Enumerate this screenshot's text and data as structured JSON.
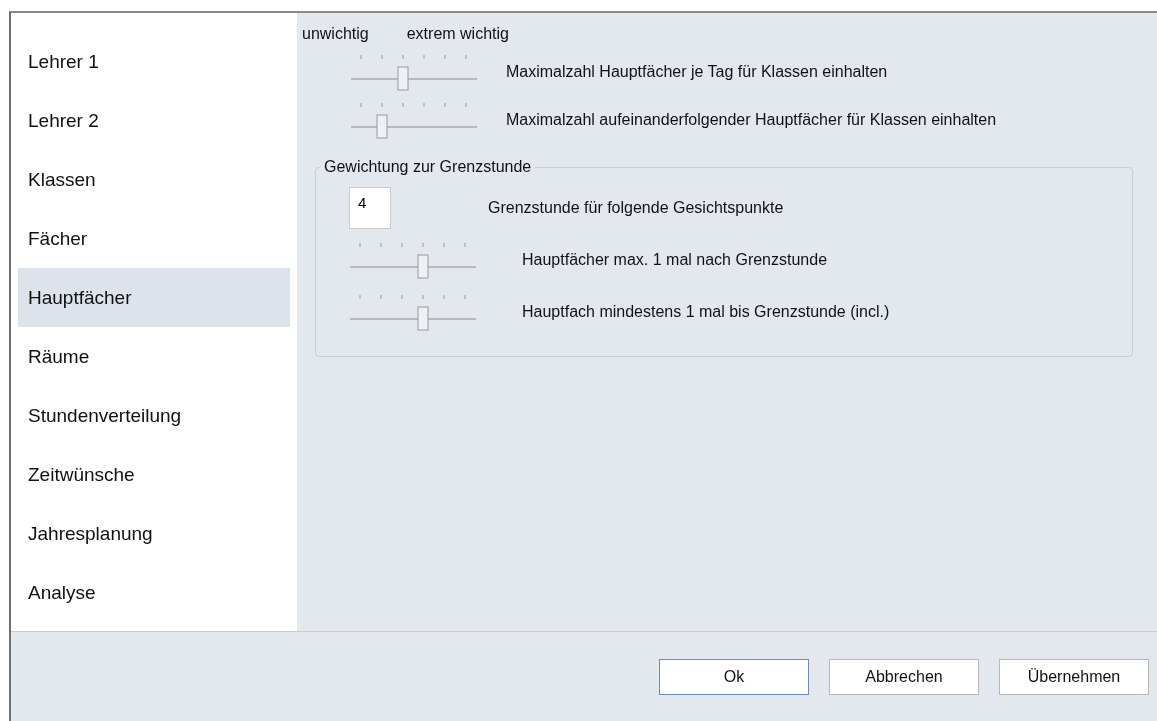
{
  "sidebar": {
    "items": [
      {
        "label": "Lehrer 1",
        "selected": false
      },
      {
        "label": "Lehrer 2",
        "selected": false
      },
      {
        "label": "Klassen",
        "selected": false
      },
      {
        "label": "Fächer",
        "selected": false
      },
      {
        "label": "Hauptfächer",
        "selected": true
      },
      {
        "label": "Räume",
        "selected": false
      },
      {
        "label": "Stundenverteilung",
        "selected": false
      },
      {
        "label": "Zeitwünsche",
        "selected": false
      },
      {
        "label": "Jahresplanung",
        "selected": false
      },
      {
        "label": "Analyse",
        "selected": false
      }
    ]
  },
  "scale": {
    "min_label": "unwichtig",
    "max_label": "extrem wichtig"
  },
  "weights": [
    {
      "label": "Maximalzahl Hauptfächer je Tag für Klassen einhalten",
      "level": 0.4
    },
    {
      "label": "Maximalzahl aufeinanderfolgender Hauptfächer für Klassen einhalten",
      "level": 0.2
    }
  ],
  "group": {
    "title": "Gewichtung zur Grenzstunde",
    "rows": [
      {
        "kind": "number",
        "value": "4",
        "label": "Grenzstunde für folgende Gesichtspunkte"
      },
      {
        "kind": "slider",
        "label": "Hauptfächer max. 1 mal nach Grenzstunde",
        "level": 0.6
      },
      {
        "kind": "slider",
        "label": "Hauptfach mindestens 1 mal bis Grenzstunde (incl.)",
        "level": 0.6
      }
    ]
  },
  "buttons": [
    {
      "label": "Ok",
      "default": true
    },
    {
      "label": "Abbrechen",
      "default": false
    },
    {
      "label": "Übernehmen",
      "default": false
    }
  ]
}
